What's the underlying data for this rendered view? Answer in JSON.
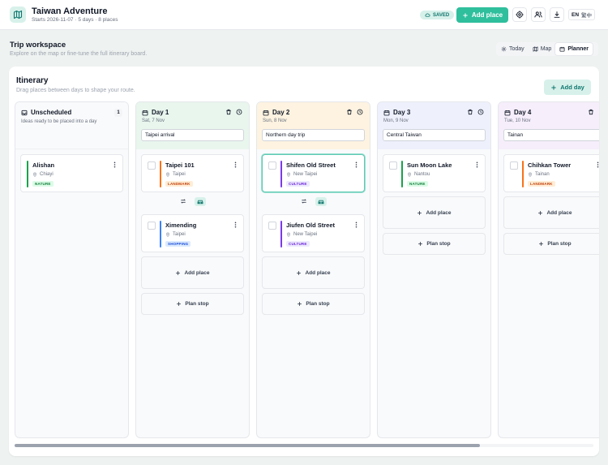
{
  "header": {
    "title": "Taiwan Adventure",
    "subtitle": "Starts 2026-11-07 · 5 days · 8 places",
    "saved_label": "SAVED",
    "add_place_label": "Add place",
    "lang_active": "EN",
    "lang_other": "繁中"
  },
  "workspace": {
    "title": "Trip workspace",
    "subtitle": "Explore on the map or fine-tune the full itinerary board.",
    "views": [
      "Today",
      "Map",
      "Planner"
    ],
    "active_view": "Planner"
  },
  "itinerary": {
    "title": "Itinerary",
    "subtitle": "Drag places between days to shape your route.",
    "add_day_label": "Add day",
    "add_place_label": "Add place",
    "plan_stop_label": "Plan stop",
    "unscheduled": {
      "title": "Unscheduled",
      "count": "1",
      "description": "Ideas ready to be placed into a day",
      "places": [
        {
          "name": "Alishan",
          "location": "Chiayi",
          "tag": "NATURE"
        }
      ]
    },
    "days": [
      {
        "title": "Day 1",
        "date": "Sat, 7 Nov",
        "note": "Taipei arrival",
        "places": [
          {
            "name": "Taipei 101",
            "location": "Taipei",
            "tag": "LANDMARK"
          },
          {
            "name": "Ximending",
            "location": "Taipei",
            "tag": "SHOPPING"
          }
        ]
      },
      {
        "title": "Day 2",
        "date": "Sun, 8 Nov",
        "note": "Northern day trip",
        "places": [
          {
            "name": "Shifen Old Street",
            "location": "New Taipei",
            "tag": "CULTURE"
          },
          {
            "name": "Jiufen Old Street",
            "location": "New Taipei",
            "tag": "CULTURE"
          }
        ]
      },
      {
        "title": "Day 3",
        "date": "Mon, 9 Nov",
        "note": "Central Taiwan",
        "places": [
          {
            "name": "Sun Moon Lake",
            "location": "Nantou",
            "tag": "NATURE"
          }
        ]
      },
      {
        "title": "Day 4",
        "date": "Tue, 10 Nov",
        "note": "Tainan",
        "places": [
          {
            "name": "Chihkan Tower",
            "location": "Tainan",
            "tag": "LANDMARK"
          }
        ]
      }
    ]
  },
  "colors": {
    "accent": "#2fbf9d",
    "nature": "#16a34a",
    "landmark": "#f97316",
    "shopping": "#3b82f6",
    "culture": "#7c3aed",
    "day1_head": "#e9f6ee",
    "day2_head": "#fdf3e0",
    "day3_head": "#eef0fc",
    "day4_head": "#f6eefb"
  },
  "icons": [
    "map-icon",
    "cloud-icon",
    "plus-icon",
    "gear-icon",
    "users-icon",
    "download-icon",
    "sun-icon",
    "map-fold-icon",
    "calendar-icon",
    "inbox-icon",
    "trash-icon",
    "clock-icon",
    "kebab-icon",
    "pin-icon",
    "swap-icon",
    "car-icon"
  ]
}
